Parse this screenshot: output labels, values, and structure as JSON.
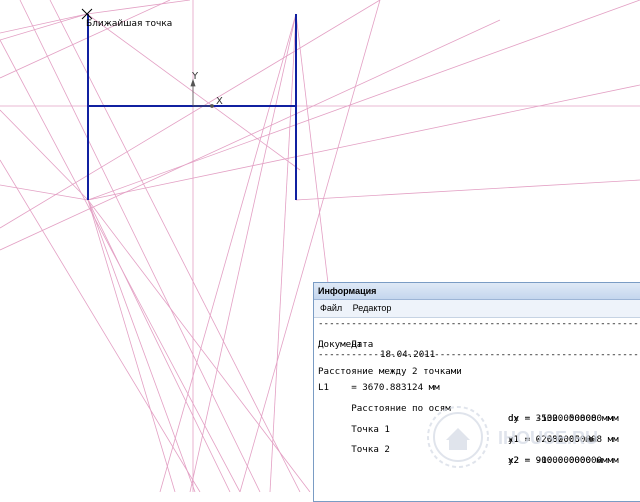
{
  "canvas": {
    "snap_label": "Ближайшая точка",
    "axis_y_label": "Y",
    "axis_x_label": "X",
    "colors": {
      "construction": "#e3a0c4",
      "geometry": "#1020a0",
      "axis": "#555555"
    }
  },
  "info_window": {
    "title": "Информация",
    "menu": {
      "file": "Файл",
      "edit": "Редактор"
    },
    "separator": "--------------------------------------------------------------------------------",
    "date_label": "Дата",
    "date_value": "18.04.2011",
    "document_label": "Документ",
    "heading": "Расстояние между 2 точками",
    "l1": "L1    = 3670.883124 мм",
    "axes_label": "Расстояние по осям",
    "dx": "dx = -1000.000000 мм",
    "dy": "dy = 3532.050808 мм",
    "point1_label": "Точка 1",
    "x1": "x1 = 0.000000 мм",
    "y1": "y1 = -2632.050808 мм",
    "point2_label": "Точка 2",
    "x2": "x2 = -1000.000000 мм",
    "y2": "y2 = 900.000000 мм"
  },
  "watermark": {
    "text": "IHOUSE.RU",
    "icon": "house-emblem-icon"
  }
}
